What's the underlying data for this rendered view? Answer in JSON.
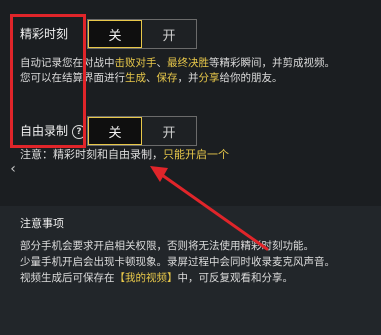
{
  "highlights": {
    "label": "精彩时刻",
    "toggle": {
      "off_label": "关",
      "on_label": "开",
      "selected": "off"
    },
    "desc_line1": {
      "a": "自动记录您在对战中",
      "b": "击败对手",
      "c": "、",
      "d": "最终决胜",
      "e": "等精彩瞬间，并剪成视频。"
    },
    "desc_line2": {
      "a": "您可以在结算界面进行",
      "b": "生成",
      "c": "、",
      "d": "保存",
      "e": "，并",
      "f": "分享",
      "g": "给你的朋友。"
    }
  },
  "free_record": {
    "label": "自由录制",
    "help_icon": "help-circle-icon",
    "toggle": {
      "off_label": "关",
      "on_label": "开",
      "selected": "off"
    }
  },
  "warning": {
    "prefix": "注意：精彩时刻和自由录制，",
    "highlight": "只能开启一个"
  },
  "notice": {
    "title": "注意事项",
    "line1": "部分手机会要求开启相关权限，否则将无法使用精彩时刻功能。",
    "line2": "少量手机开启会出现卡顿现象。录屏过程中会同时收录麦克风声音。",
    "line3": {
      "a": "视频生成后可保存在",
      "b": "【我的视频】",
      "c": "中，可反复观看和分享。"
    }
  },
  "nav": {
    "left_arrow_icon": "chevron-left-icon",
    "left_arrow_glyph": "‹"
  },
  "colors": {
    "annotation_red": "#e0252a",
    "accent_yellow": "#e8c84a",
    "accent_green": "#6fcf6f"
  }
}
